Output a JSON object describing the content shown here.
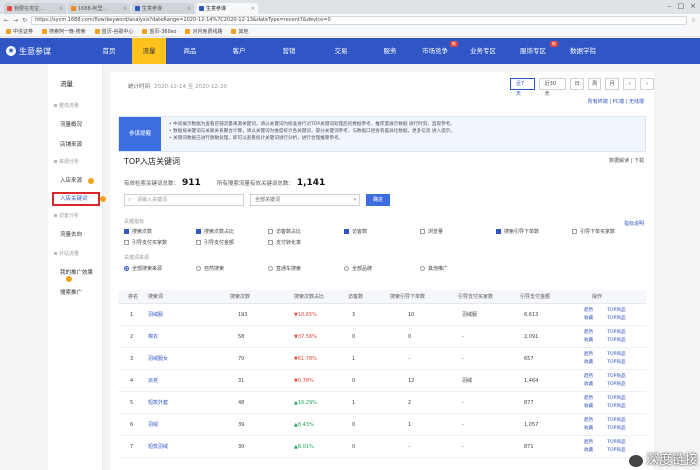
{
  "browser": {
    "tabs": [
      {
        "label": "我要在淘宝..."
      },
      {
        "label": "1688-阿里..."
      },
      {
        "label": "生意参谋"
      },
      {
        "label": "生意参谋"
      }
    ],
    "active_tab": 3,
    "url": "https://sycm.1688.com/flow/keyword/analysis?dateRange=2020-12-14%7C2020-12-13&dateType=recent7&device=0",
    "bookmarks": [
      "中信证券",
      "搜索阿一晚·搜索",
      "首页-谷歌中心",
      "首页-360so",
      "对内免费线路",
      "其他"
    ]
  },
  "nav": {
    "brand": "生意参谋",
    "items": [
      {
        "label": "首页"
      },
      {
        "label": "流量"
      },
      {
        "label": "商品"
      },
      {
        "label": "客户"
      },
      {
        "label": "营销"
      },
      {
        "label": "交易"
      },
      {
        "label": "服务"
      },
      {
        "label": "市场竞争",
        "badge": "新"
      },
      {
        "label": "业务专区"
      },
      {
        "label": "服饰专区",
        "badge": "新"
      },
      {
        "label": "数据学院"
      }
    ]
  },
  "sidebar": {
    "title": "流量",
    "groups": [
      {
        "head": "整体流量",
        "items": [
          "流量概况",
          "店铺来源"
        ]
      },
      {
        "head": "来源分析",
        "items": [
          "入店来源",
          "入店关键词"
        ]
      },
      {
        "head": "访客分析",
        "items": [
          "流量去向"
        ]
      },
      {
        "head": "外站流量",
        "items": [
          "我的推广效果",
          "搜索推广"
        ]
      }
    ],
    "selected": "入店关键词"
  },
  "main": {
    "date_label": "统计时间",
    "date_value": "2020-12-14 至 2020-12-20",
    "period_buttons": [
      "近7天",
      "近30天",
      "日",
      "周",
      "月"
    ],
    "devices": "所有终端 | PC端 | 无线端",
    "notice_tag": "参谋提醒",
    "notice_lines": [
      "• 中间展示数据为查看店铺流量来源关键词，请以关键词为标准进行对TOP关键词处理后的数据参考，推荐量展示数据 进行时刻，直观参考。",
      "• 数据按关键词与关联关系聚合计算，请以关键词为维度统计各关键词，部分关键词参考，与数据口径会有差异化数据，更多信息 进入提示。",
      "• 关键词数据已进行脱敏处理，即可以查看统计关键词进行分析，进行合理推算参考。"
    ],
    "section_title": "TOP入店关键词",
    "section_links": "数据解读 | 下载",
    "stats": [
      {
        "label": "有效检索关键词总数：",
        "value": "911"
      },
      {
        "label": "所有搜索流量有效关键词总数：",
        "value": "1,141"
      }
    ],
    "search_placeholder": "请输入关键词",
    "select_value": "全部关键词",
    "go_label": "确定",
    "filter_note": "指标说明",
    "filter_label_1": "关键指标",
    "filter_label_2": "关键词来源",
    "checkboxes": [
      {
        "label": "搜索次数",
        "checked": true
      },
      {
        "label": "搜索次数占比",
        "checked": true
      },
      {
        "label": "访客数占比",
        "checked": false
      },
      {
        "label": "访客数",
        "checked": true
      },
      {
        "label": "浏览量",
        "checked": false
      },
      {
        "label": "搜索引导下单数",
        "checked": true
      },
      {
        "label": "引导下单买家数",
        "checked": false
      },
      {
        "label": "引导支付买家数",
        "checked": false
      },
      {
        "label": "引导支付金额",
        "checked": false
      },
      {
        "label": "支付转化率",
        "checked": false
      }
    ],
    "radios": [
      {
        "label": "全部搜索来源",
        "checked": true
      },
      {
        "label": "自然搜索",
        "checked": false
      },
      {
        "label": "直通车搜索",
        "checked": false
      },
      {
        "label": "全部品牌",
        "checked": false
      },
      {
        "label": "其他推广",
        "checked": false
      }
    ],
    "table": {
      "headers": [
        "排名",
        "搜索词",
        "搜索次数",
        "搜索次数占比",
        "访客数",
        "搜索引导下单数",
        "引导支付买家数",
        "引导支付金额",
        "操作"
      ],
      "rows": [
        {
          "rank": "1",
          "keyword": "羽绒服",
          "searches": "193",
          "ratio": "10.65%",
          "dir": "down",
          "visitors": "3",
          "orders": "10",
          "buyers": "羽绒服",
          "amount": "6,613",
          "ops": [
            "趋势",
            "TOP商品",
            "收藏",
            "TOP商品"
          ]
        },
        {
          "rank": "2",
          "keyword": "棉衣",
          "searches": "58",
          "ratio": "37.56%",
          "dir": "down",
          "visitors": "0",
          "orders": "0",
          "buyers": "-",
          "amount": "2,091",
          "ops": [
            "趋势",
            "TOP商品",
            "收藏",
            "TOP商品"
          ]
        },
        {
          "rank": "3",
          "keyword": "羽绒服女",
          "searches": "70",
          "ratio": "61.78%",
          "dir": "down",
          "visitors": "1",
          "orders": "-",
          "buyers": "-",
          "amount": "657",
          "ops": [
            "趋势",
            "TOP商品",
            "收藏",
            "TOP商品"
          ]
        },
        {
          "rank": "4",
          "keyword": "派克",
          "searches": "31",
          "ratio": "0.78%",
          "dir": "down",
          "visitors": "0",
          "orders": "12",
          "buyers": "羽绒",
          "amount": "1,464",
          "ops": [
            "趋势",
            "TOP商品",
            "收藏",
            "TOP商品"
          ]
        },
        {
          "rank": "5",
          "keyword": "短款外套",
          "searches": "48",
          "ratio": "16.29%",
          "dir": "up",
          "visitors": "1",
          "orders": "2",
          "buyers": "-",
          "amount": "877",
          "ops": [
            "趋势",
            "TOP商品",
            "收藏",
            "TOP商品"
          ]
        },
        {
          "rank": "6",
          "keyword": "羽绒",
          "searches": "39",
          "ratio": "8.43%",
          "dir": "up",
          "visitors": "0",
          "orders": "1",
          "buyers": "-",
          "amount": "1,057",
          "ops": [
            "趋势",
            "TOP商品",
            "收藏",
            "TOP商品"
          ]
        },
        {
          "rank": "7",
          "keyword": "短款羽绒",
          "searches": "30",
          "ratio": "8.01%",
          "dir": "up",
          "visitors": "0",
          "orders": "-",
          "buyers": "-",
          "amount": "871",
          "ops": [
            "趋势",
            "TOP商品",
            "收藏",
            "TOP商品"
          ]
        }
      ]
    }
  },
  "watermark": "深度链接"
}
